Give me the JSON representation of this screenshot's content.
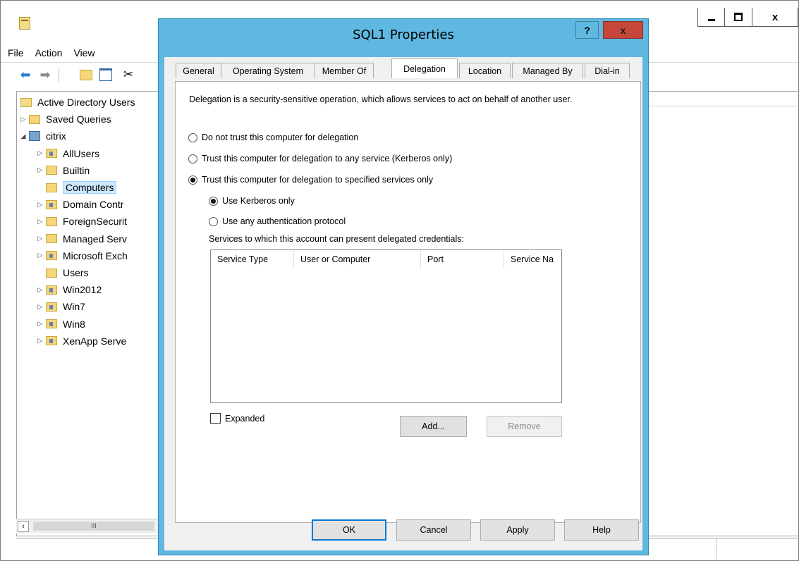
{
  "mmc": {
    "menu": [
      "File",
      "Action",
      "View"
    ],
    "tree": [
      {
        "label": "Active Directory Users",
        "kind": "root"
      },
      {
        "label": "Saved Queries",
        "kind": "folder",
        "expander": "▷"
      },
      {
        "label": "citrix",
        "kind": "domain",
        "expander": "◢"
      },
      {
        "label": "AllUsers",
        "kind": "ou",
        "expander": "▷"
      },
      {
        "label": "Builtin",
        "kind": "folder",
        "expander": "▷"
      },
      {
        "label": "Computers",
        "kind": "folder",
        "expander": "",
        "selected": true
      },
      {
        "label": "Domain Contr",
        "kind": "ou",
        "expander": "▷"
      },
      {
        "label": "ForeignSecurit",
        "kind": "folder",
        "expander": "▷"
      },
      {
        "label": "Managed Serv",
        "kind": "folder",
        "expander": "▷"
      },
      {
        "label": "Microsoft Exch",
        "kind": "ou",
        "expander": "▷"
      },
      {
        "label": "Users",
        "kind": "folder",
        "expander": ""
      },
      {
        "label": "Win2012",
        "kind": "ou",
        "expander": "▷"
      },
      {
        "label": "Win7",
        "kind": "ou",
        "expander": "▷"
      },
      {
        "label": "Win8",
        "kind": "ou",
        "expander": "▷"
      },
      {
        "label": "XenApp Serve",
        "kind": "ou",
        "expander": "▷"
      }
    ],
    "scroll_thumb": "III"
  },
  "dialog": {
    "title": "SQL1 Properties",
    "help_glyph": "?",
    "close_glyph": "x",
    "tabs": [
      "General",
      "Operating System",
      "Member Of",
      "Delegation",
      "Location",
      "Managed By",
      "Dial-in"
    ],
    "active_tab": "Delegation",
    "description": "Delegation is a security-sensitive operation, which allows services to act on behalf of another user.",
    "options": {
      "no_trust": "Do not trust this computer for delegation",
      "trust_any": "Trust this computer for delegation to any service (Kerberos only)",
      "trust_specified": "Trust this computer for delegation to specified services only",
      "kerberos_only": "Use Kerberos only",
      "any_protocol": "Use any authentication protocol"
    },
    "selected": {
      "trust": "trust_specified",
      "protocol": "kerberos_only"
    },
    "services_label": "Services to which this account can present delegated credentials:",
    "columns": [
      "Service Type",
      "User or Computer",
      "Port",
      "Service Na"
    ],
    "expanded_label": "Expanded",
    "expanded_checked": false,
    "add_label": "Add...",
    "remove_label": "Remove",
    "ok_label": "OK",
    "cancel_label": "Cancel",
    "apply_label": "Apply",
    "help_label": "Help"
  }
}
